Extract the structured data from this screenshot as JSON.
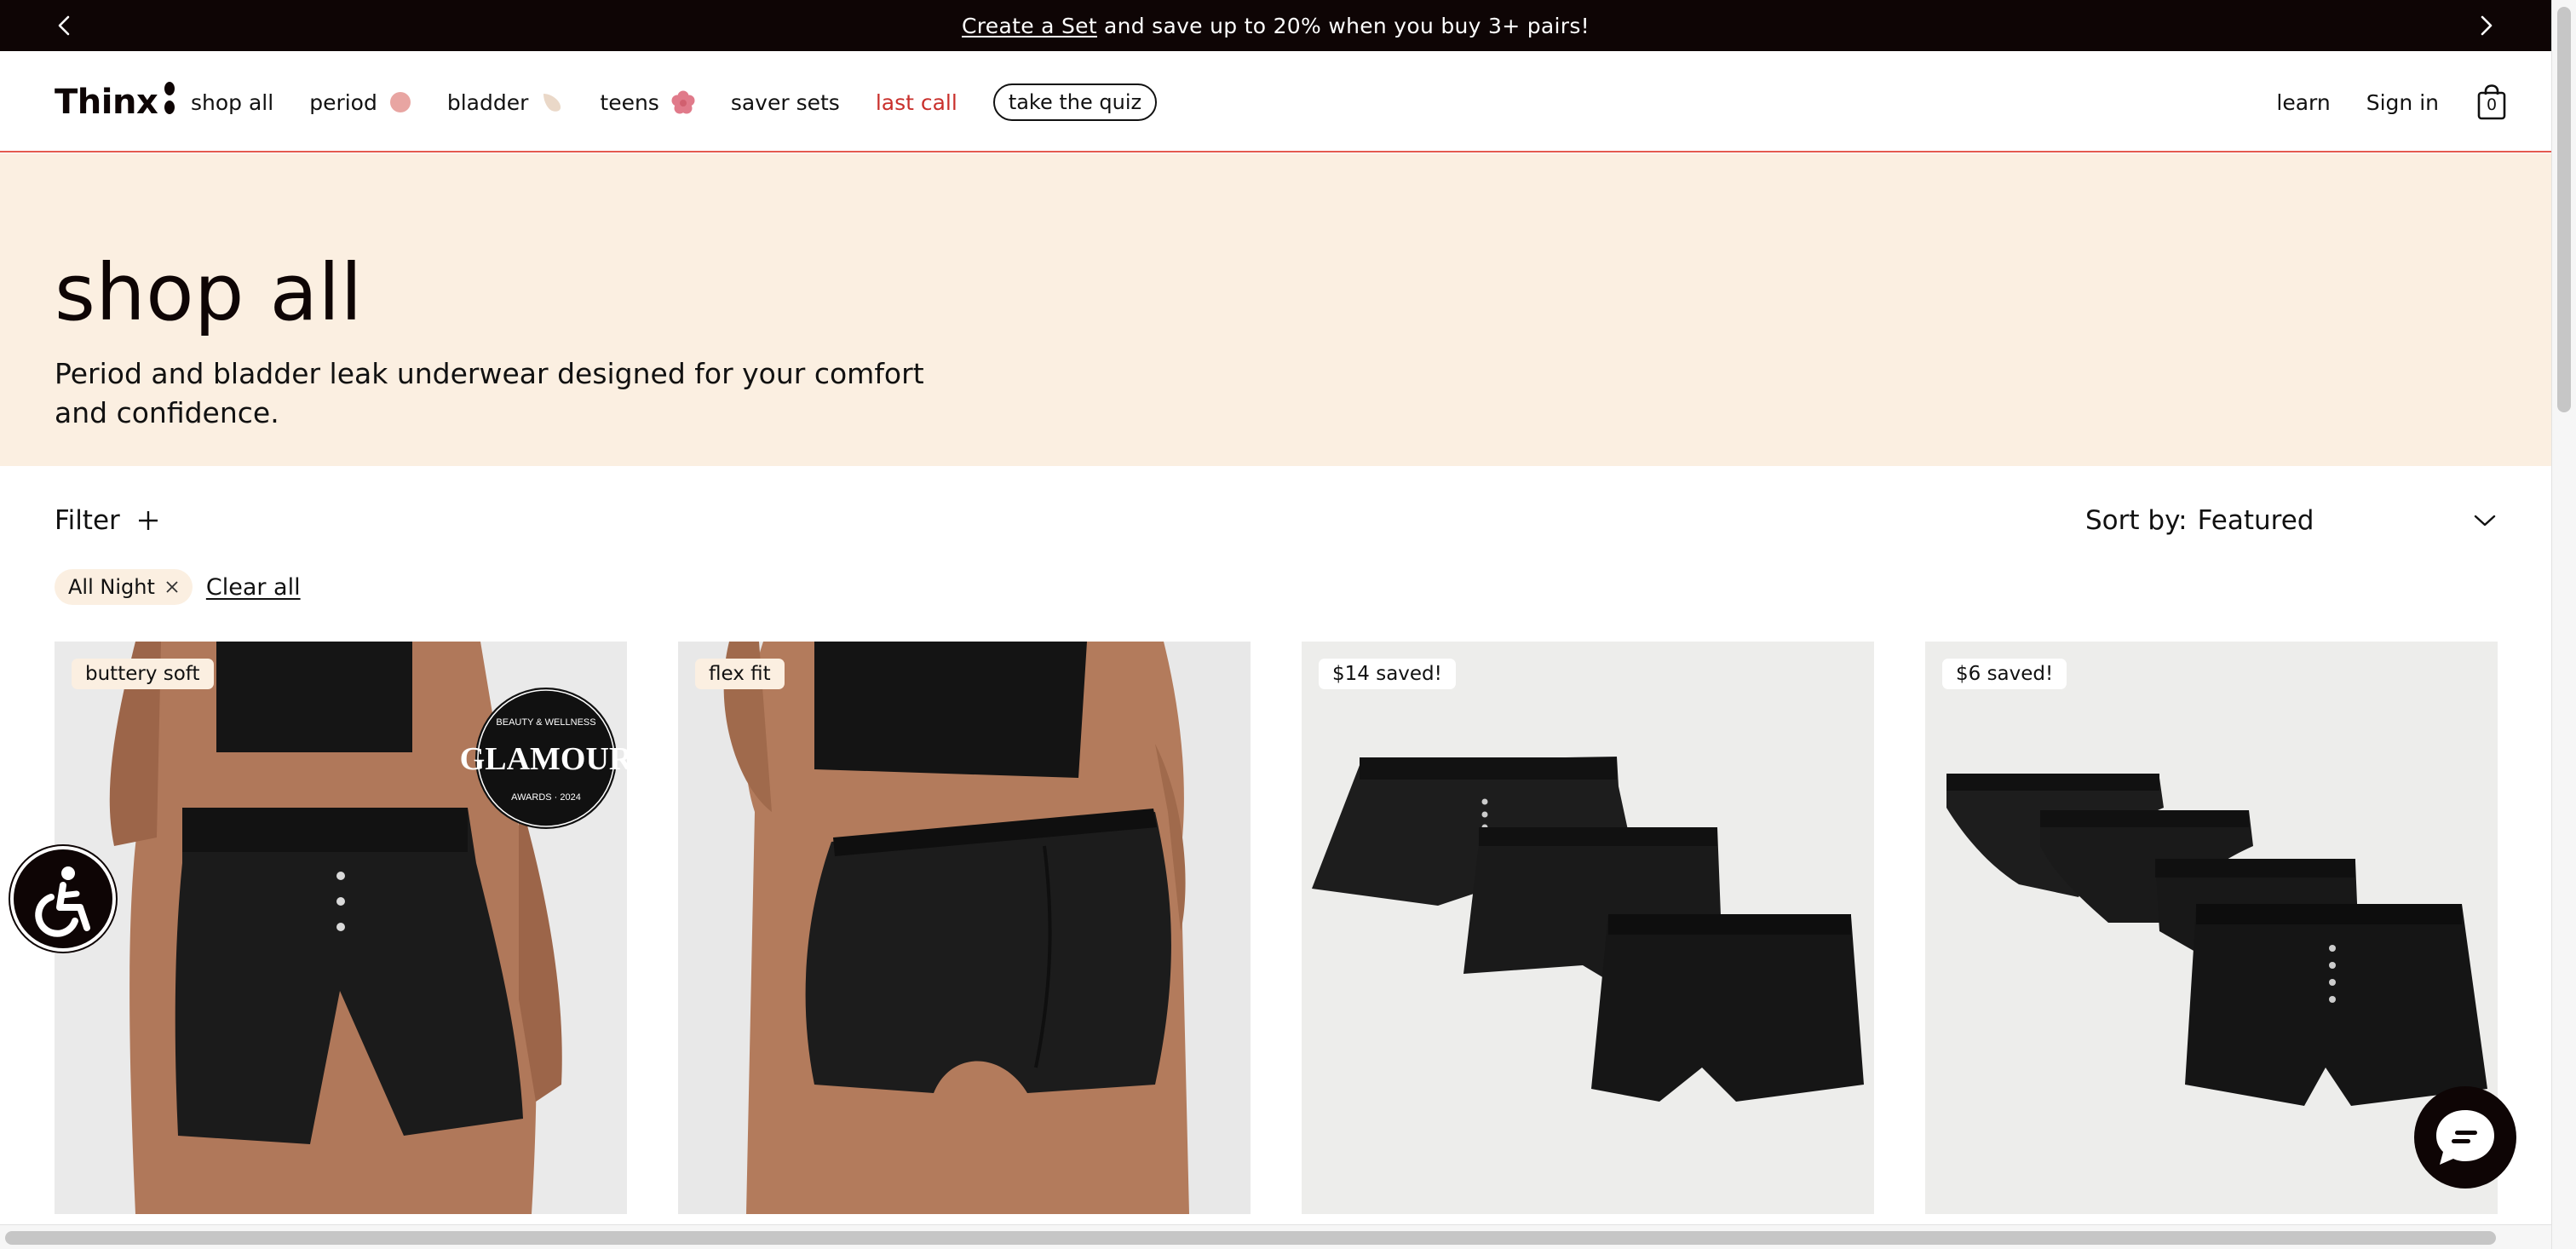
{
  "announcement": {
    "link_text": "Create a Set",
    "text": "and save up to 20% when you buy 3+ pairs!",
    "prev_icon": "chevron-left-icon",
    "next_icon": "chevron-right-icon"
  },
  "header": {
    "logo": "Thinx",
    "nav": [
      {
        "label": "shop all"
      },
      {
        "label": "period",
        "icon": "period-dot-icon"
      },
      {
        "label": "bladder",
        "icon": "bladder-drop-icon"
      },
      {
        "label": "teens",
        "icon": "flower-icon"
      },
      {
        "label": "saver sets"
      },
      {
        "label": "last call"
      }
    ],
    "quiz_label": "take the quiz",
    "learn_label": "learn",
    "signin_label": "Sign in",
    "cart_count": "0"
  },
  "hero": {
    "title": "shop all",
    "subtitle": "Period and bladder leak underwear designed for your comfort and confidence."
  },
  "toolbar": {
    "filter_label": "Filter",
    "sort_label": "Sort by:",
    "sort_value": "Featured"
  },
  "active_filters": {
    "chips": [
      "All Night"
    ],
    "clear_label": "Clear all"
  },
  "products": [
    {
      "badge": "buttery soft",
      "award": "GLAMOUR",
      "award_top": "BEAUTY & WELLNESS",
      "award_bottom": "AWARDS · 2024"
    },
    {
      "badge": "flex fit"
    },
    {
      "badge": "$14 saved!"
    },
    {
      "badge": "$6 saved!"
    }
  ],
  "colors": {
    "announcement_bg": "#0e0505",
    "hero_bg": "#fbefe1",
    "accent_red": "#c9302c",
    "header_rule": "#e45a4f",
    "card_bg": "#ededeb"
  },
  "widgets": {
    "accessibility_icon": "wheelchair-accessibility-icon",
    "chat_icon": "chat-bubble-icon"
  }
}
